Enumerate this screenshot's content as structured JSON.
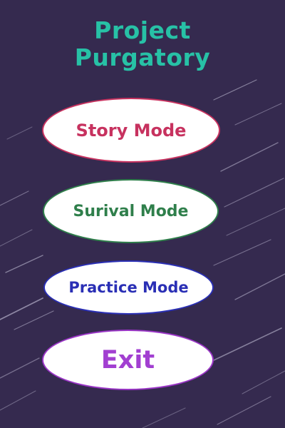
{
  "title": {
    "line1": "Project",
    "line2": "Purgatory"
  },
  "menu": {
    "story": "Story Mode",
    "survival": "Surival Mode",
    "practice": "Practice Mode",
    "exit": "Exit"
  },
  "colors": {
    "background": "#352a4f",
    "title": "#27c1a6",
    "story": "#c7325f",
    "survival": "#2f7f4b",
    "practice": "#2a2fb5",
    "exit": "#a23fd1",
    "streak": "#bfbcd6"
  }
}
